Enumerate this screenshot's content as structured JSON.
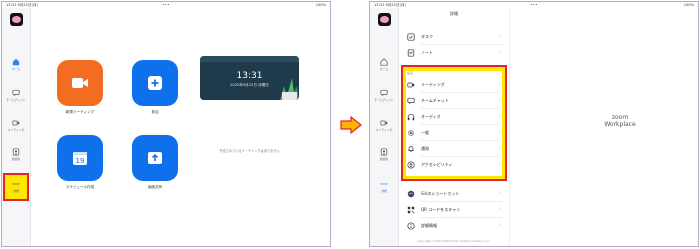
{
  "status_bar": {
    "time_date": "13:31 9月22日(月)",
    "battery": "100%"
  },
  "left_screen": {
    "sidebar": [
      {
        "label": "ホーム",
        "icon": "home-icon",
        "active": true
      },
      {
        "label": "チームチャット",
        "icon": "chat-icon"
      },
      {
        "label": "ミーティング",
        "icon": "video-icon"
      },
      {
        "label": "連絡先",
        "icon": "contacts-icon"
      },
      {
        "label": "詳細",
        "icon": "more-icon"
      }
    ],
    "tiles": [
      {
        "label": "新規ミーティング",
        "color": "#f26d21",
        "icon": "video-camera-icon"
      },
      {
        "label": "参加",
        "color": "#0e71eb",
        "icon": "plus-icon"
      },
      {
        "label": "スケジュール作成",
        "color": "#0e71eb",
        "icon": "calendar-icon",
        "calendar_day": "19"
      },
      {
        "label": "画面共有",
        "color": "#0e71eb",
        "icon": "share-screen-icon"
      }
    ],
    "card": {
      "time": "13:31",
      "date": "2025年9月22日 月曜日"
    },
    "empty_message": "予定されているミーティングはありません"
  },
  "right_screen": {
    "sidebar": [
      {
        "label": "ホーム",
        "icon": "home-icon"
      },
      {
        "label": "チームチャット",
        "icon": "chat-icon"
      },
      {
        "label": "ミーティング",
        "icon": "video-icon"
      },
      {
        "label": "連絡先",
        "icon": "contacts-icon"
      },
      {
        "label": "詳細",
        "icon": "more-icon",
        "active": true
      }
    ],
    "menu_title": "詳細",
    "top_items": [
      {
        "label": "タスク",
        "icon": "task-icon"
      },
      {
        "label": "ノート",
        "icon": "note-icon"
      }
    ],
    "settings_label": "設定",
    "settings_items": [
      {
        "label": "ミーティング",
        "icon": "video-icon"
      },
      {
        "label": "チームチャット",
        "icon": "chat-icon"
      },
      {
        "label": "オーディオ",
        "icon": "headphones-icon"
      },
      {
        "label": "一般",
        "icon": "gear-icon"
      },
      {
        "label": "通知",
        "icon": "bell-icon"
      },
      {
        "label": "アクセシビリティ",
        "icon": "accessibility-icon"
      }
    ],
    "bottom_items": [
      {
        "label": "Siriのショートカット",
        "icon": "siri-icon"
      },
      {
        "label": "QR コードをスキャン",
        "icon": "qr-code-icon"
      },
      {
        "label": "詳細情報",
        "icon": "info-icon"
      }
    ],
    "copyright": "Copyright ©2012-2025 Zoom Communications, Inc.",
    "logo_line1": "zoom",
    "logo_line2": "Workplace"
  },
  "colors": {
    "highlight_border": "#e0242c",
    "highlight_fill": "#ffe600",
    "accent_blue": "#0e71eb",
    "accent_orange": "#f26d21"
  }
}
